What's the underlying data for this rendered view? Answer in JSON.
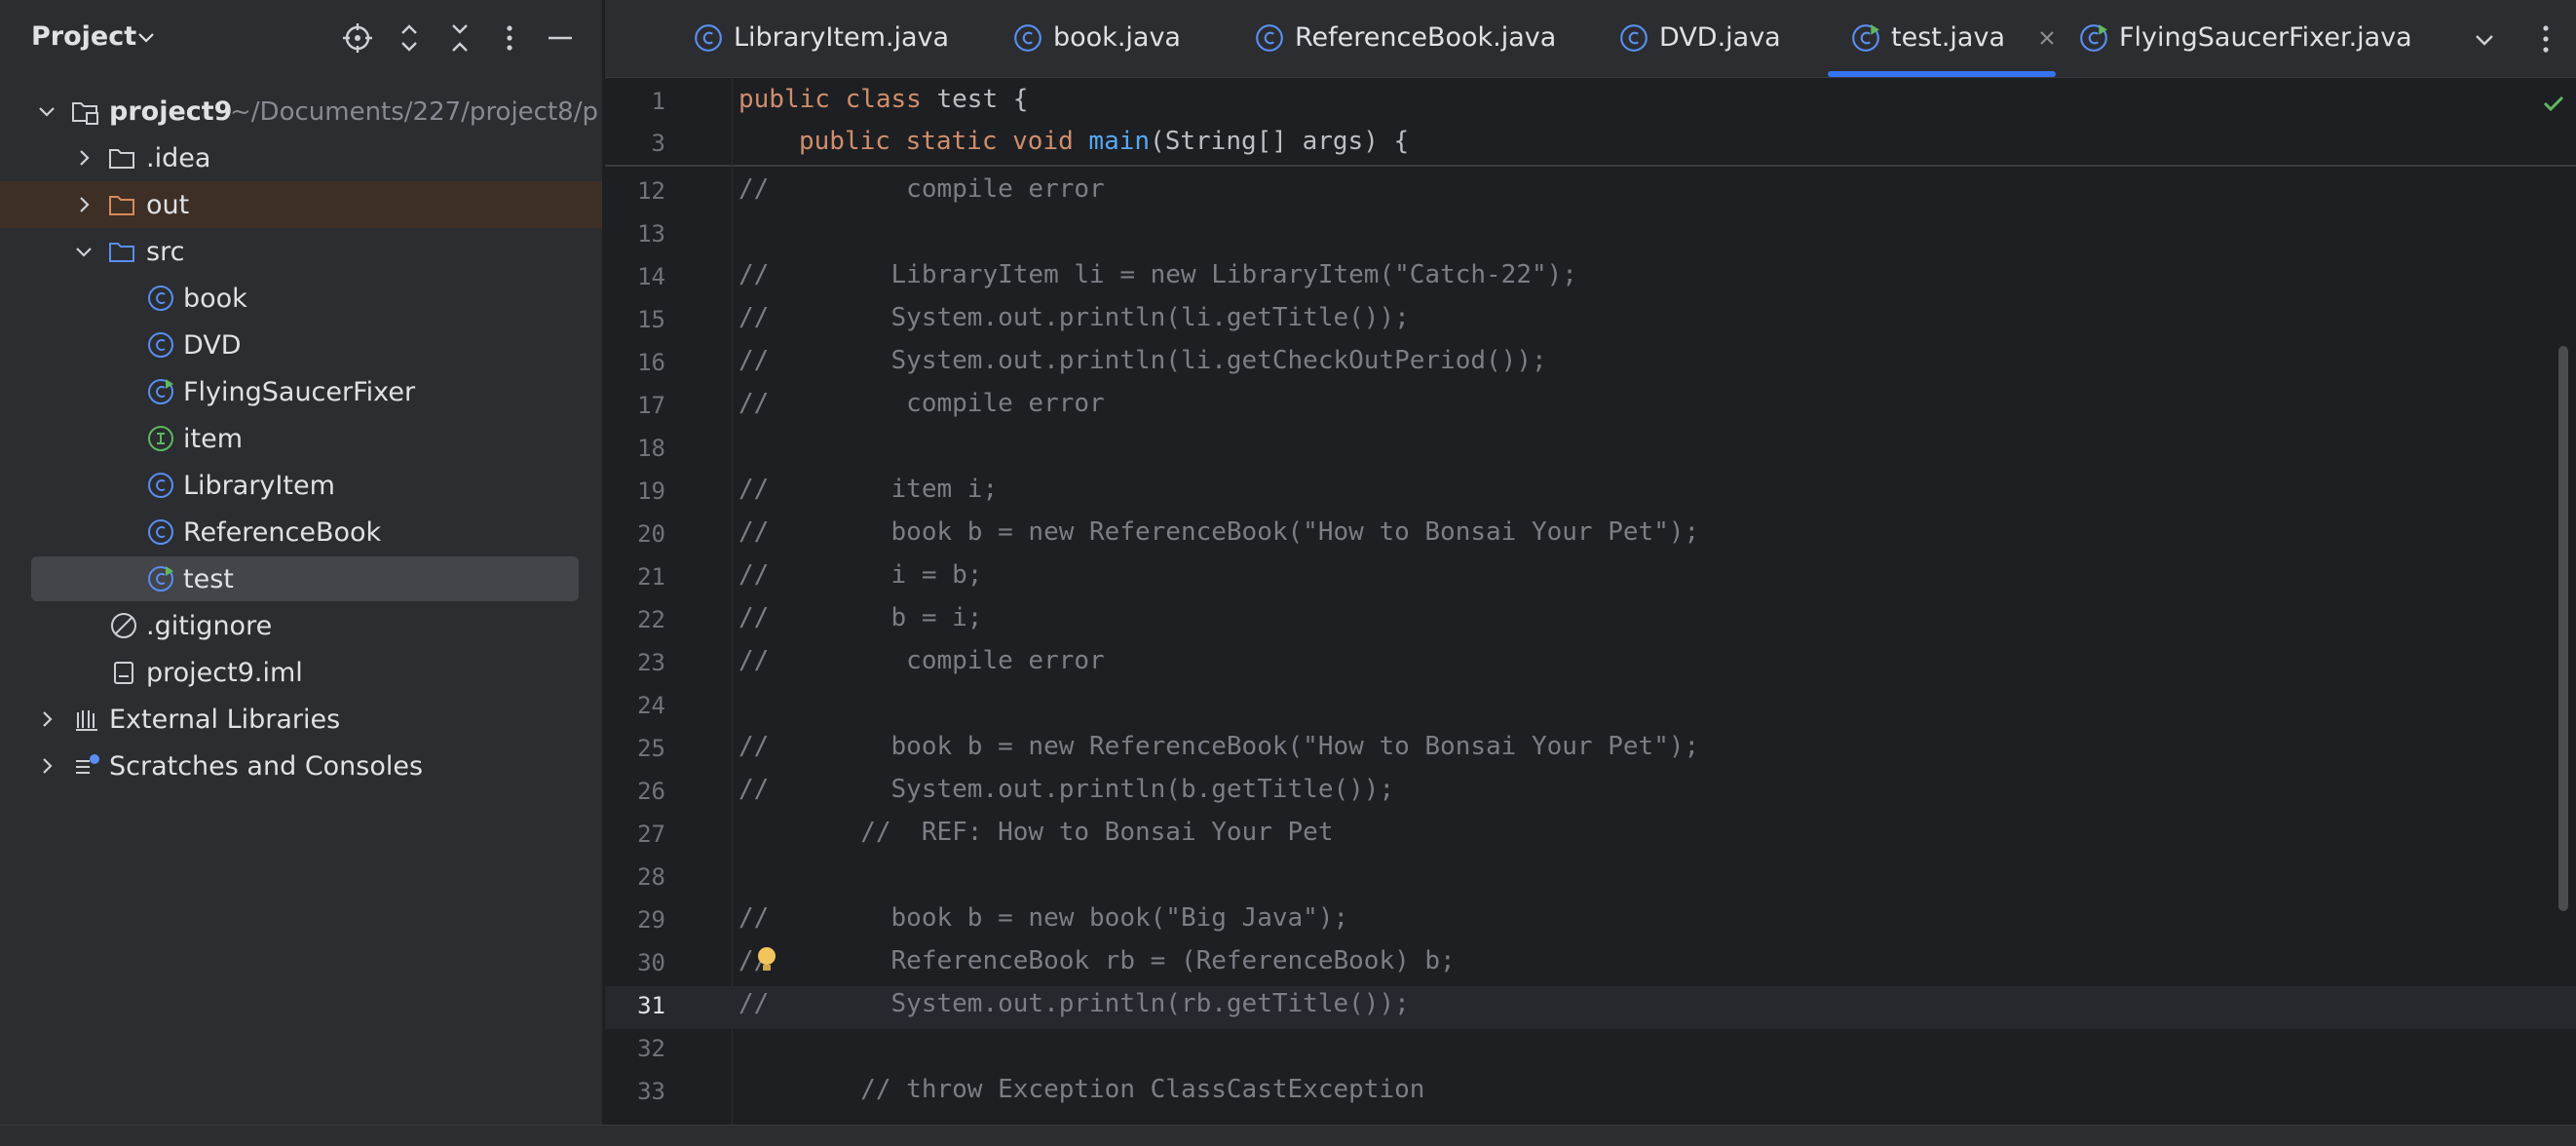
{
  "panel": {
    "title": "Project",
    "tree": [
      {
        "label": "project9",
        "path": "~/Documents/227/project8/p",
        "icon": "module-folder-icon",
        "expanded": true
      },
      {
        "label": ".idea",
        "icon": "folder-icon"
      },
      {
        "label": "out",
        "icon": "folder-excluded-icon"
      },
      {
        "label": "src",
        "icon": "source-folder-icon",
        "expanded": true
      },
      {
        "label": "book",
        "icon": "class-icon"
      },
      {
        "label": "DVD",
        "icon": "class-icon"
      },
      {
        "label": "FlyingSaucerFixer",
        "icon": "runnable-class-icon"
      },
      {
        "label": "item",
        "icon": "interface-icon"
      },
      {
        "label": "LibraryItem",
        "icon": "class-icon"
      },
      {
        "label": "ReferenceBook",
        "icon": "class-icon"
      },
      {
        "label": "test",
        "icon": "runnable-class-icon",
        "selected": true
      },
      {
        "label": ".gitignore",
        "icon": "ignore-file-icon"
      },
      {
        "label": "project9.iml",
        "icon": "iml-file-icon"
      },
      {
        "label": "External Libraries",
        "icon": "libraries-icon"
      },
      {
        "label": "Scratches and Consoles",
        "icon": "scratches-icon"
      }
    ]
  },
  "tabs": [
    {
      "label": "LibraryItem.java",
      "icon": "class-icon"
    },
    {
      "label": "book.java",
      "icon": "class-icon"
    },
    {
      "label": "ReferenceBook.java",
      "icon": "class-icon"
    },
    {
      "label": "DVD.java",
      "icon": "class-icon"
    },
    {
      "label": "test.java",
      "icon": "runnable-class-icon",
      "active": true
    },
    {
      "label": "FlyingSaucerFixer.java",
      "icon": "runnable-class-icon"
    }
  ],
  "sticky": [
    {
      "num": "1",
      "kw1": "public class",
      "rest": " test {"
    },
    {
      "num": "3",
      "kw1": "public static void",
      "fn": "main",
      "rest": "(String[] args) {"
    }
  ],
  "code": [
    {
      "num": "12",
      "text": "//         compile error"
    },
    {
      "num": "13",
      "text": ""
    },
    {
      "num": "14",
      "text": "//        LibraryItem li = new LibraryItem(\"Catch-22\");"
    },
    {
      "num": "15",
      "text": "//        System.out.println(li.getTitle());"
    },
    {
      "num": "16",
      "text": "//        System.out.println(li.getCheckOutPeriod());"
    },
    {
      "num": "17",
      "text": "//         compile error"
    },
    {
      "num": "18",
      "text": ""
    },
    {
      "num": "19",
      "text": "//        item i;"
    },
    {
      "num": "20",
      "text": "//        book b = new ReferenceBook(\"How to Bonsai Your Pet\");"
    },
    {
      "num": "21",
      "text": "//        i = b;"
    },
    {
      "num": "22",
      "text": "//        b = i;"
    },
    {
      "num": "23",
      "text": "//         compile error"
    },
    {
      "num": "24",
      "text": ""
    },
    {
      "num": "25",
      "text": "//        book b = new ReferenceBook(\"How to Bonsai Your Pet\");"
    },
    {
      "num": "26",
      "text": "//        System.out.println(b.getTitle());"
    },
    {
      "num": "27",
      "text": "        //  REF: How to Bonsai Your Pet"
    },
    {
      "num": "28",
      "text": ""
    },
    {
      "num": "29",
      "text": "//        book b = new book(\"Big Java\");"
    },
    {
      "num": "30",
      "text": "//        ReferenceBook rb = (ReferenceBook) b;"
    },
    {
      "num": "31",
      "text": "//        System.out.println(rb.getTitle());",
      "current": true
    },
    {
      "num": "32",
      "text": ""
    },
    {
      "num": "33",
      "text": "        // throw Exception ClassCastException"
    }
  ],
  "colors": {
    "accent": "#3574f0",
    "class_icon": "#5a8ef0",
    "interface_icon": "#5fb85f",
    "run_badge": "#5fb85f"
  }
}
